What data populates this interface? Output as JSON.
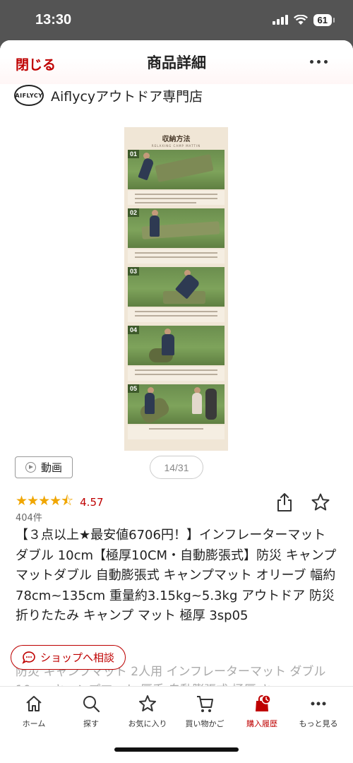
{
  "status": {
    "time": "13:30",
    "battery": "61"
  },
  "header": {
    "close_label": "閉じる",
    "title": "商品詳細"
  },
  "shop": {
    "logo_text": "AIFLYCY",
    "name": "Aiflycyアウトドア専門店"
  },
  "gallery": {
    "heading": "収納方法",
    "subheading": "RELAXING CAMP MATTIN",
    "steps": [
      "01",
      "02",
      "03",
      "04",
      "05"
    ],
    "counter": "14/31"
  },
  "video_label": "動画",
  "rating": {
    "stars": 4.57,
    "value": "4.57",
    "count": "404件"
  },
  "product": {
    "title": "【３点以上★最安値6706円！】インフレーターマット ダブル 10cm【極厚10CM・自動膨張式】防災 キャンプマットダブル 自動膨張式 キャンプマット オリーブ 幅約78cm~135cm 重量約3.15kg~5.3kg アウトドア 防災 折りたたみ キャンプ マット 極厚 3sp05",
    "description": "防災 キャンプマット 2人用 インフレーターマット ダブル10cm キャンプマット 厚手 自動膨張式 極厚 キ"
  },
  "chat_label": "ショップへ相談",
  "tabs": [
    {
      "label": "ホーム",
      "icon": "home-icon"
    },
    {
      "label": "探す",
      "icon": "search-icon"
    },
    {
      "label": "お気に入り",
      "icon": "star-icon"
    },
    {
      "label": "買い物かご",
      "icon": "cart-icon"
    },
    {
      "label": "購入履歴",
      "icon": "purchase-history-icon",
      "active": true
    },
    {
      "label": "もっと見る",
      "icon": "more-icon"
    }
  ],
  "colors": {
    "accent": "#bf0000",
    "star": "#f0a600"
  }
}
